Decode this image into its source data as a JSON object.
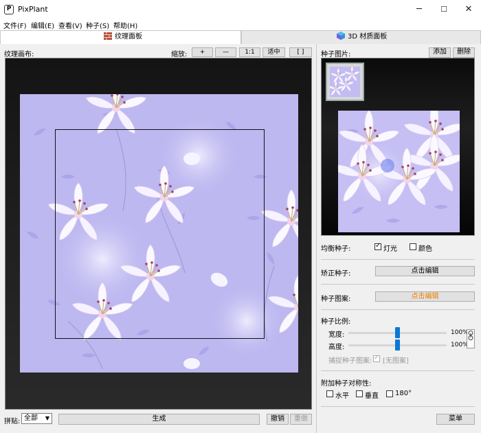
{
  "window": {
    "title": "PixPlant",
    "minimize": "─",
    "maximize": "☐",
    "close": "✕"
  },
  "menu": [
    "文件(F)",
    "编辑(E)",
    "查看(V)",
    "种子(S)",
    "帮助(H)"
  ],
  "tabs": [
    {
      "label": "纹理面板",
      "active": true,
      "icon": "texture-icon"
    },
    {
      "label": "3D 材质面板",
      "active": false,
      "icon": "cube-icon"
    }
  ],
  "canvas": {
    "label": "纹理画布:",
    "zoom_label": "缩放:",
    "zoom_in": "+",
    "zoom_out": "—",
    "zoom_actual": "1:1",
    "zoom_fit": "适中",
    "zoom_frame": "[ ]"
  },
  "seed": {
    "label": "种子图片:",
    "add": "添加",
    "delete": "删除",
    "balance_label": "均衡种子:",
    "light_label": "灯光",
    "light_checked": true,
    "color_label": "颜色",
    "color_checked": false,
    "straighten_label": "矫正种子:",
    "straighten_button": "点击编辑",
    "pattern_label": "种子图案:",
    "pattern_button": "点击编辑",
    "scale_label": "种子比例:",
    "width_label": "宽度:",
    "width_value": "100%",
    "width_level": 0.5,
    "height_label": "高度:",
    "height_value": "100%",
    "height_level": 0.5,
    "capture_label": "捕捉种子图案:",
    "capture_value": "[无图案]",
    "symmetry_label": "附加种子对称性:",
    "sym_horizontal": "水平",
    "sym_vertical": "垂直",
    "sym_180": "180°",
    "menu_button": "菜单"
  },
  "bottom": {
    "tile_label": "拼贴:",
    "tile_value": "全部",
    "generate": "生成",
    "undo": "撤销",
    "redo": "重做"
  },
  "colors": {
    "texture_bg": "#bdb8f0",
    "accent": "#0a78d6",
    "orange": "#f07e00"
  }
}
